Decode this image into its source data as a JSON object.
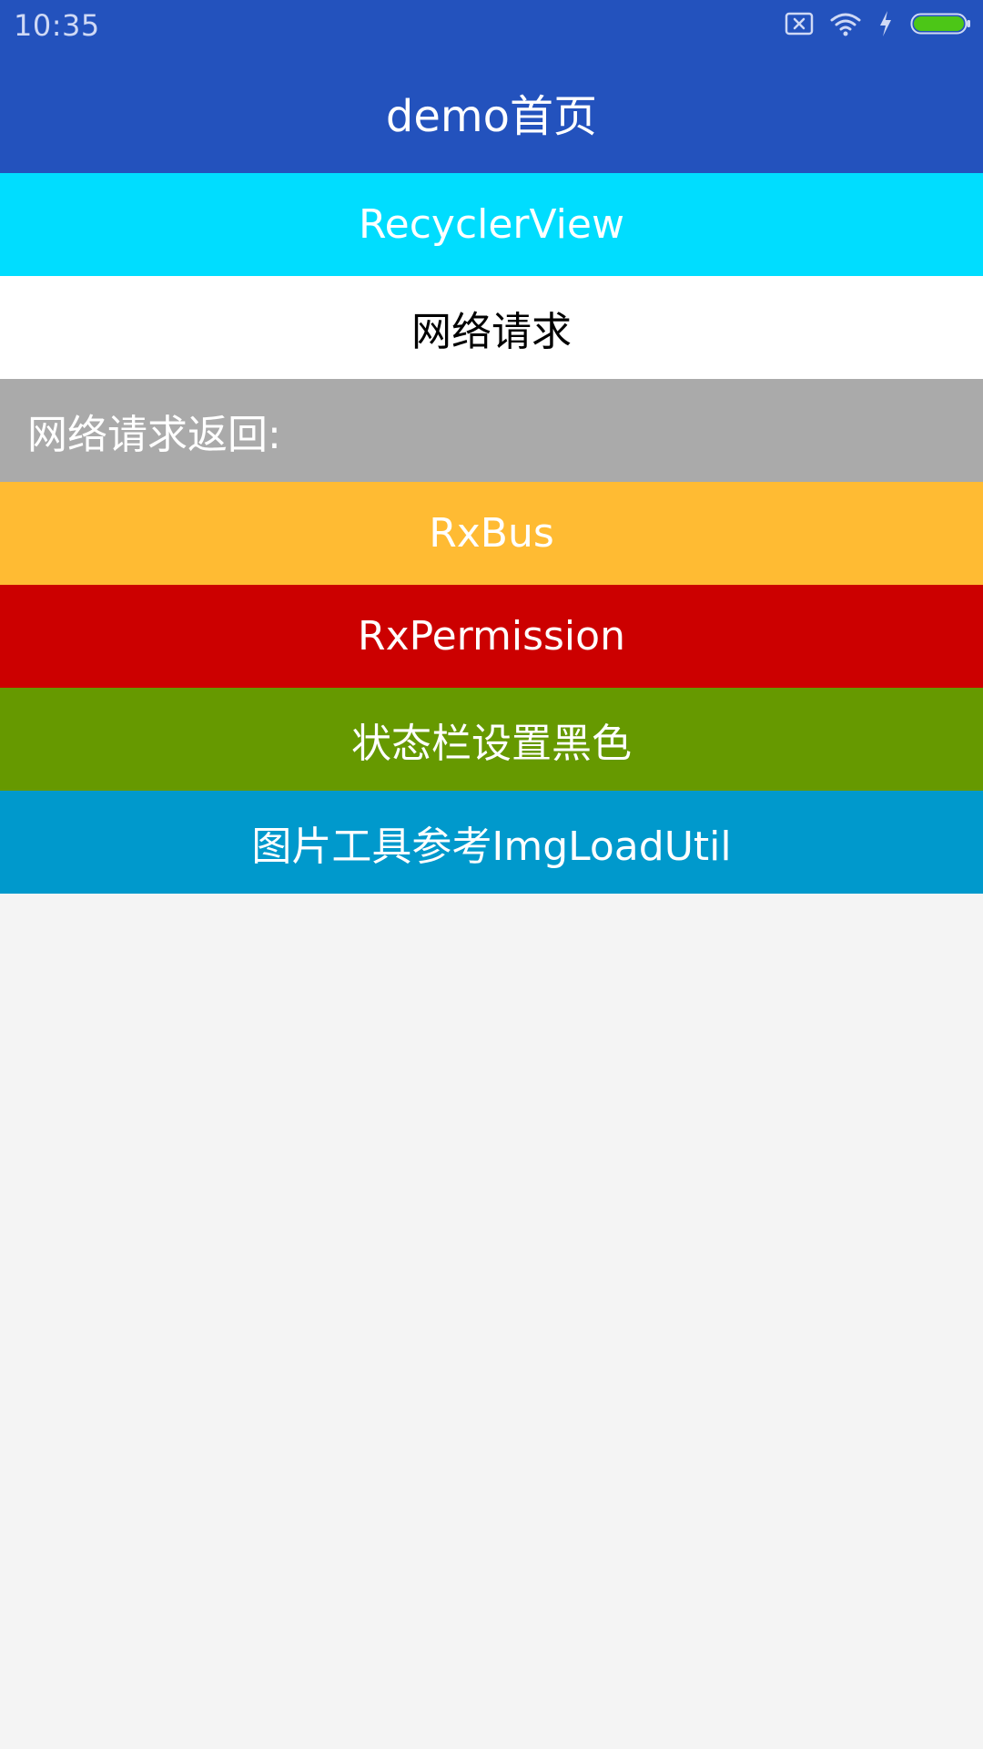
{
  "status_bar": {
    "time": "10:35",
    "icons": [
      "sim-off-icon",
      "wifi-icon",
      "charging-icon",
      "battery-icon"
    ],
    "color": "#2352bd"
  },
  "app_bar": {
    "title": "demo首页",
    "color": "#2352bd"
  },
  "menu": {
    "recycler": {
      "label": "RecyclerView",
      "color": "#00ddff"
    },
    "network": {
      "label": "网络请求",
      "color": "#ffffff"
    },
    "network_result": {
      "label": "网络请求返回:",
      "color": "#aaaaaa"
    },
    "rxbus": {
      "label": "RxBus",
      "color": "#ffbb33"
    },
    "rxpermission": {
      "label": "RxPermission",
      "color": "#cc0000"
    },
    "statusbar_black": {
      "label": "状态栏设置黑色",
      "color": "#669900"
    },
    "imgload": {
      "label": "图片工具参考ImgLoadUtil",
      "color": "#0099cc"
    }
  },
  "background_color": "#f4f4f4"
}
